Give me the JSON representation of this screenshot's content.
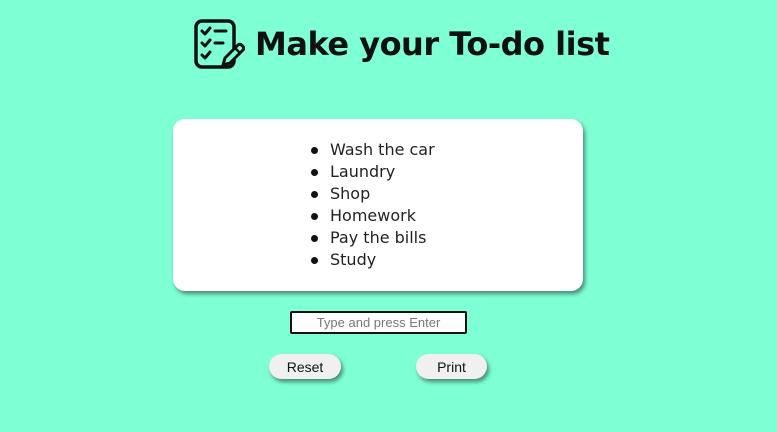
{
  "header": {
    "icon": "checklist-edit-icon",
    "title": "Make your To-do list"
  },
  "todo_list": {
    "items": [
      "Wash the car",
      "Laundry",
      "Shop",
      "Homework",
      "Pay the bills",
      "Study"
    ]
  },
  "input": {
    "value": "",
    "placeholder": "Type and press Enter"
  },
  "buttons": {
    "reset_label": "Reset",
    "print_label": "Print"
  },
  "colors": {
    "background": "#7fffd4",
    "card": "#ffffff",
    "button": "#f0f0f0",
    "text": "#111111"
  }
}
